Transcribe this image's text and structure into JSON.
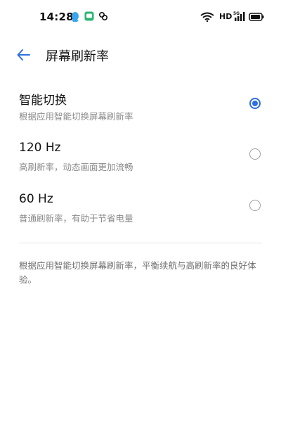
{
  "status_bar": {
    "time": "14:28",
    "network_label": "HD",
    "network_type": "5G",
    "icons": [
      "qq-icon",
      "chat-icon",
      "link-icon",
      "wifi-icon",
      "signal-icon",
      "battery-icon"
    ]
  },
  "header": {
    "title": "屏幕刷新率",
    "back_icon": "back-arrow-icon"
  },
  "options": [
    {
      "title": "智能切换",
      "subtitle": "根据应用智能切换屏幕刷新率",
      "selected": true
    },
    {
      "title": "120 Hz",
      "subtitle": "高刷新率，动态画面更加流畅",
      "selected": false
    },
    {
      "title": "60 Hz",
      "subtitle": "普通刷新率，有助于节省电量",
      "selected": false
    }
  ],
  "description": "根据应用智能切换屏幕刷新率，平衡续航与高刷新率的良好体验。",
  "colors": {
    "accent": "#2f6fe0",
    "text_primary": "#111111",
    "text_secondary": "#8a8a8a",
    "divider": "#e6e6e6"
  }
}
